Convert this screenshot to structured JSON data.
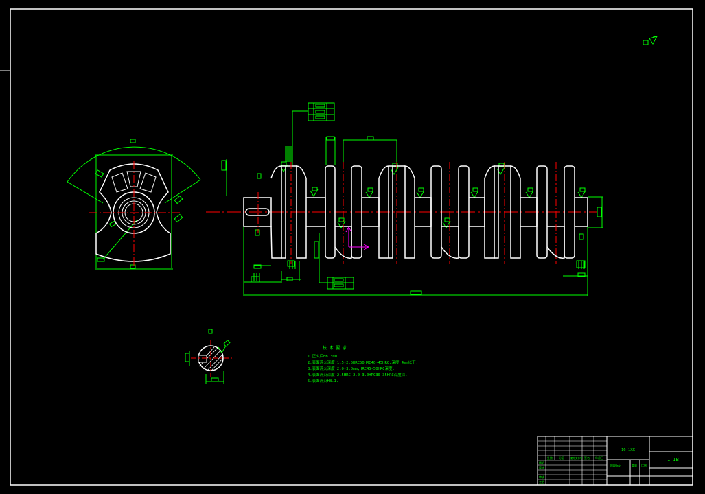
{
  "drawing": {
    "notes_title": "技 术 要 求",
    "notes": [
      "1.正火后HB 300.",
      "2.表面淬火深度 1.5-2.5HRC50HRC40~45HRC,深度 4mm以下.",
      "3.表面淬火深度 2.0-3.0mm,HRC45-50HRC深度.",
      "4.表面淬火深度 2.5HRC 2.0-3.0HRC30-35HRC深度深.",
      "5.表面淬火HB.1."
    ],
    "title_block": {
      "part_name": "16 1XX",
      "drawing_no": "1 1B",
      "row_labels": [
        "标记",
        "设计",
        "审核",
        "工艺"
      ],
      "col_labels": [
        "处数",
        "分区",
        "更改文件号",
        "签名",
        "年月日"
      ],
      "material_label": "阶段标记",
      "weight_label": "重量",
      "scale_label": "比例"
    }
  },
  "colors": {
    "outline": "#ffffff",
    "dimension": "#00ff00",
    "centerline": "#ff0000",
    "highlight": "#ff00ff",
    "background": "#000000"
  }
}
